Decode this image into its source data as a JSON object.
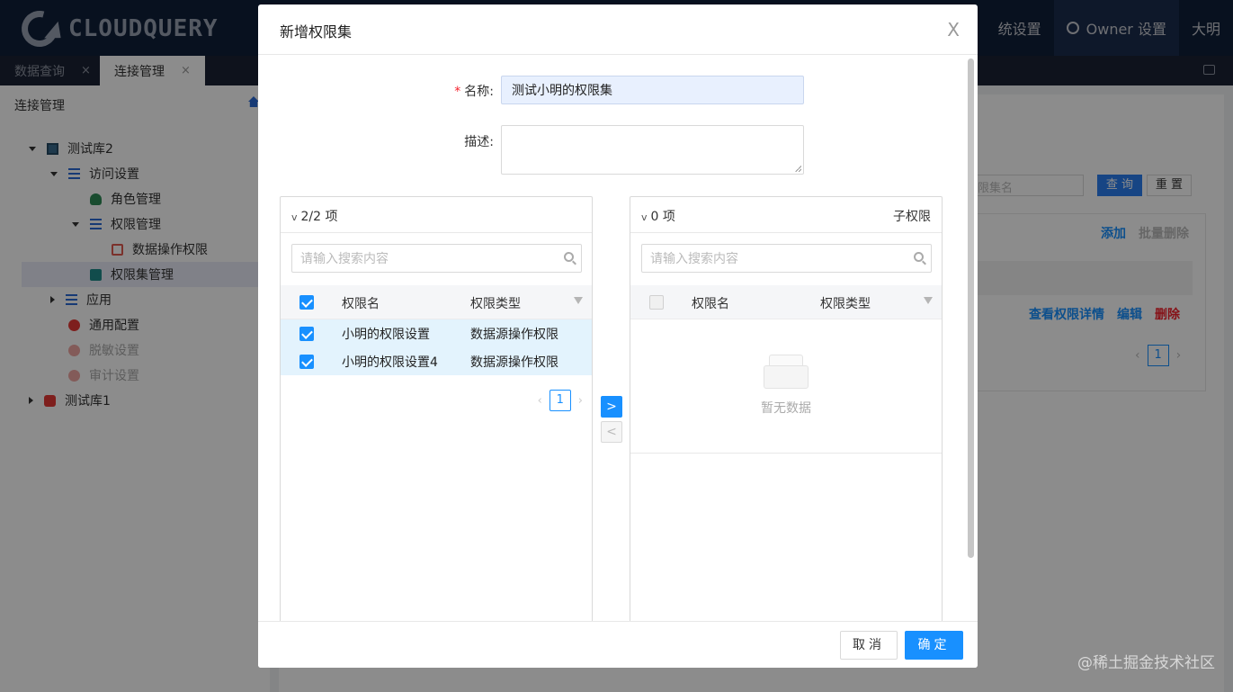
{
  "app": {
    "logo_text": "CLOUDQUERY",
    "top_menu": {
      "system_settings": "统设置",
      "owner_settings": "Owner 设置",
      "user": "大明"
    }
  },
  "tabs": [
    {
      "label": "数据查询",
      "close": "×"
    },
    {
      "label": "连接管理",
      "close": "×"
    }
  ],
  "sidebar": {
    "title": "连接管理",
    "tree": [
      {
        "label": "测试库2"
      },
      {
        "label": "访问设置"
      },
      {
        "label": "角色管理"
      },
      {
        "label": "权限管理"
      },
      {
        "label": "数据操作权限"
      },
      {
        "label": "权限集管理"
      },
      {
        "label": "应用"
      },
      {
        "label": "通用配置"
      },
      {
        "label": "脱敏设置"
      },
      {
        "label": "审计设置"
      },
      {
        "label": "测试库1"
      }
    ]
  },
  "background": {
    "search_placeholder": "限集名",
    "query_button": "查 询",
    "reset_button": "重 置",
    "add_link": "添加",
    "batch_delete_link": "批量删除",
    "view_detail_link": "查看权限详情",
    "edit_link": "编辑",
    "delete_link": "删除",
    "page": "1"
  },
  "modal": {
    "title": "新增权限集",
    "close": "X",
    "name_label": "名称:",
    "name_required": "*",
    "name_value": "测试小明的权限集",
    "desc_label": "描述:",
    "desc_value": "",
    "left_list": {
      "count": "2/2 项",
      "search_placeholder": "请输入搜索内容",
      "col_name": "权限名",
      "col_type": "权限类型",
      "rows": [
        {
          "name": "小明的权限设置",
          "type": "数据源操作权限",
          "checked": true
        },
        {
          "name": "小明的权限设置4",
          "type": "数据源操作权限",
          "checked": true
        }
      ],
      "page": "1"
    },
    "right_list": {
      "count": "0 项",
      "title": "子权限",
      "search_placeholder": "请输入搜索内容",
      "col_name": "权限名",
      "col_type": "权限类型",
      "empty_text": "暂无数据"
    },
    "move_right": ">",
    "move_left": "<",
    "cancel_button": "取消",
    "ok_button": "确定"
  },
  "watermark": "@稀土掘金技术社区",
  "colors": {
    "primary": "#1890ff",
    "topbar": "#0f1f3a",
    "danger": "#f5222d"
  }
}
